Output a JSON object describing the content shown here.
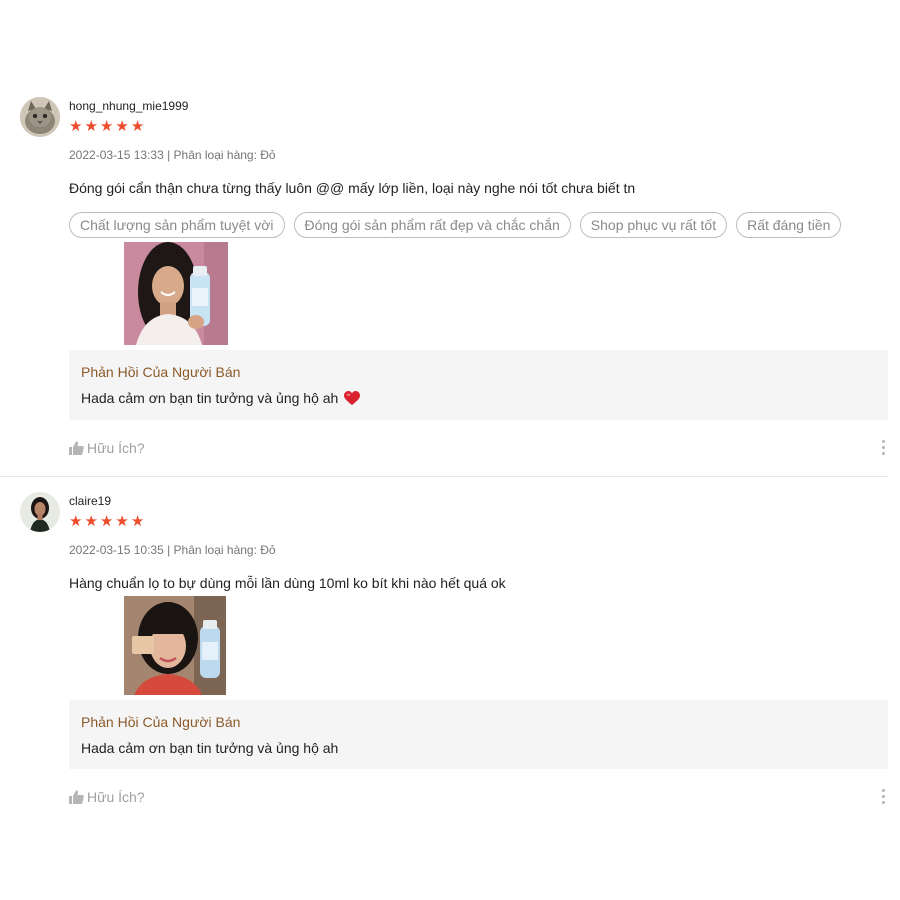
{
  "reviews": [
    {
      "username": "hong_nhung_mie1999",
      "rating": 5,
      "meta": "2022-03-15 13:33 | Phân loại hàng: Đỏ",
      "comment": "Đóng gói cẩn thận chưa từng thấy luôn @@ mấy lớp liền, loại này nghe nói tốt chưa biết tn",
      "tags": [
        "Chất lượng sản phẩm tuyệt vời",
        "Đóng gói sản phẩm rất đẹp và chắc chắn",
        "Shop phục vụ rất tốt",
        "Rất đáng tiền"
      ],
      "seller_reply": {
        "title": "Phản Hồi Của Người Bán",
        "text": "Hada cảm ơn bạn tin tưởng và ủng hộ ah",
        "icon": "red-heart-emoji"
      },
      "helpful_label": "Hữu Ích?"
    },
    {
      "username": "claire19",
      "rating": 5,
      "meta": "2022-03-15 10:35 | Phân loại hàng: Đỏ",
      "comment": "Hàng chuẩn lọ to bự dùng mỗi lần dùng 10ml ko bít khi nào hết quá ok",
      "seller_reply": {
        "title": "Phản Hồi Của Người Bán",
        "text": "Hada cảm ơn bạn tin tưởng và ủng hộ ah"
      },
      "helpful_label": "Hữu Ích?"
    }
  ],
  "colors": {
    "star": "#ee4d2d",
    "reply_title": "#8b5a2b",
    "reply_bg": "#f5f5f5"
  }
}
